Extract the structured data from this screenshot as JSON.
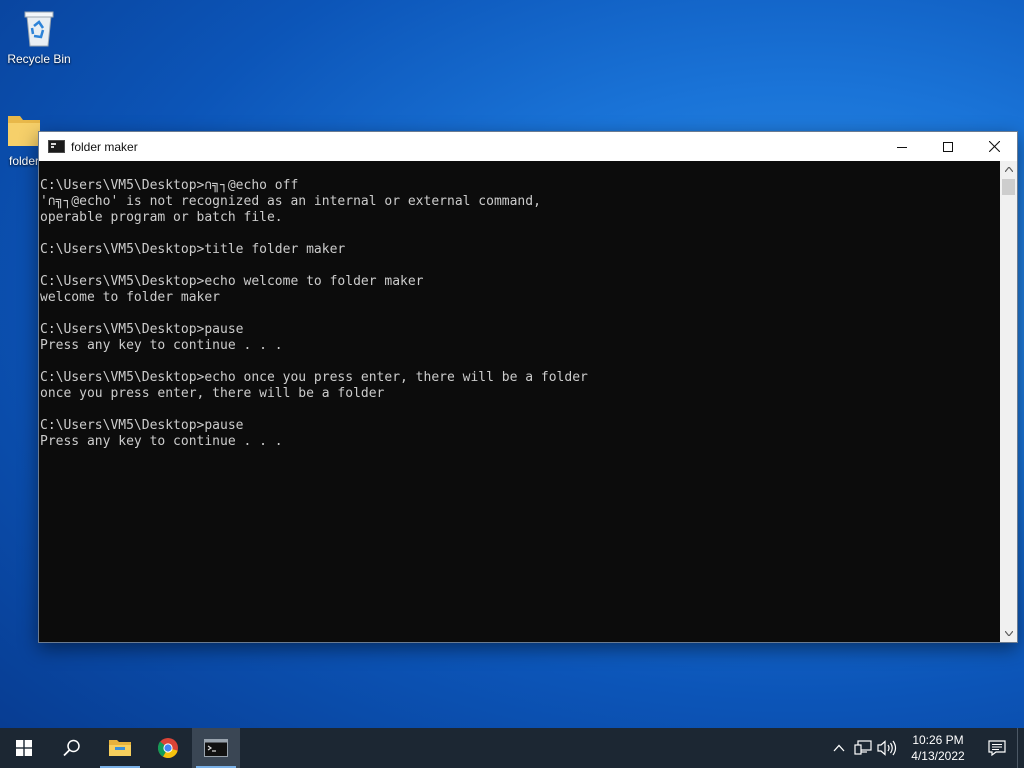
{
  "desktop": {
    "icons": [
      {
        "label": "Recycle Bin"
      },
      {
        "label": "folder"
      }
    ]
  },
  "window": {
    "title": "folder maker",
    "console_lines": [
      "C:\\Users\\VM5\\Desktop>∩╗┐@echo off",
      "'∩╗┐@echo' is not recognized as an internal or external command,",
      "operable program or batch file.",
      "",
      "C:\\Users\\VM5\\Desktop>title folder maker",
      "",
      "C:\\Users\\VM5\\Desktop>echo welcome to folder maker",
      "welcome to folder maker",
      "",
      "C:\\Users\\VM5\\Desktop>pause",
      "Press any key to continue . . .",
      "",
      "C:\\Users\\VM5\\Desktop>echo once you press enter, there will be a folder",
      "once you press enter, there will be a folder",
      "",
      "C:\\Users\\VM5\\Desktop>pause",
      "Press any key to continue . . ."
    ]
  },
  "taskbar": {
    "clock_time": "10:26 PM",
    "clock_date": "4/13/2022"
  },
  "colors": {
    "console_bg": "#0c0c0c",
    "console_text": "#cccccc",
    "taskbar_bg": "#1c2733",
    "accent": "#7ab1e8"
  }
}
